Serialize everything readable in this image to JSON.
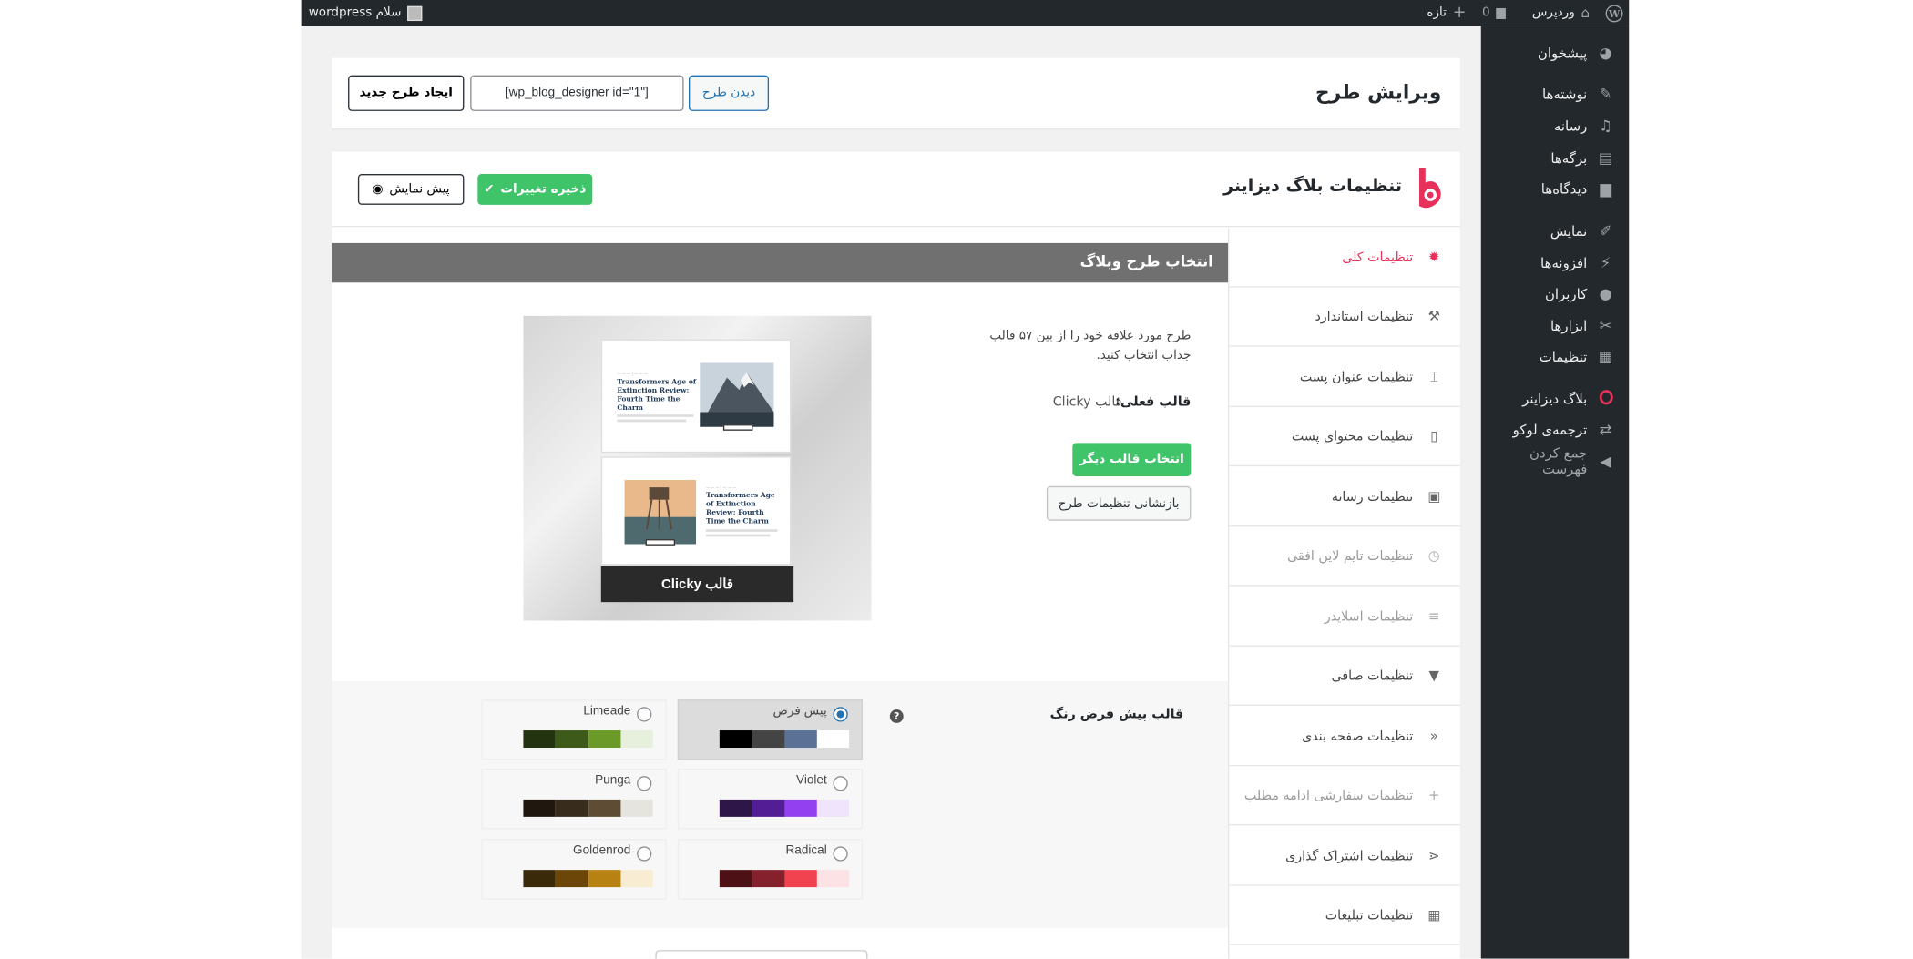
{
  "admin_bar": {
    "site_name": "وردپرس",
    "comments_count": "0",
    "new_label": "تازه",
    "greeting": "سلام wordpress"
  },
  "sidebar": {
    "items": [
      {
        "label": "پیشخوان",
        "icon": "dashboard-icon"
      },
      {
        "label": "نوشته‌ها",
        "icon": "pin-icon"
      },
      {
        "label": "رسانه",
        "icon": "media-icon"
      },
      {
        "label": "برگه‌ها",
        "icon": "pages-icon"
      },
      {
        "label": "دیدگاه‌ها",
        "icon": "comment-icon"
      },
      {
        "label": "نمایش",
        "icon": "brush-icon"
      },
      {
        "label": "افزونه‌ها",
        "icon": "plugin-icon"
      },
      {
        "label": "کاربران",
        "icon": "user-icon"
      },
      {
        "label": "ابزارها",
        "icon": "wrench-icon"
      },
      {
        "label": "تنظیمات",
        "icon": "settings-icon"
      },
      {
        "label": "بلاگ دیزاینر",
        "icon": "blog-designer-icon"
      },
      {
        "label": "ترجمه‌ی لوکو",
        "icon": "translate-icon"
      },
      {
        "label": "جمع کردن فهرست",
        "icon": "collapse-icon"
      }
    ]
  },
  "header": {
    "title": "ویرایش طرح",
    "view_design": "دیدن طرح",
    "shortcode": "[wp_blog_designer id=\"1\"]",
    "create_new": "ایجاد طرح جدید"
  },
  "panel": {
    "brand_title": "تنظیمات بلاگ دیزاینر",
    "save_label": "ذخیره تغییرات",
    "preview_label": "پیش نمایش"
  },
  "tabs": [
    {
      "label": "تنظیمات کلی",
      "icon": "gear-icon",
      "state": "active"
    },
    {
      "label": "تنظیمات استاندارد",
      "icon": "hammer-icon",
      "state": "normal"
    },
    {
      "label": "تنظیمات عنوان پست",
      "icon": "title-icon",
      "state": "normal"
    },
    {
      "label": "تنظیمات محتوای پست",
      "icon": "document-icon",
      "state": "normal"
    },
    {
      "label": "تنظیمات رسانه",
      "icon": "image-icon",
      "state": "normal"
    },
    {
      "label": "تنظیمات تایم لاین افقی",
      "icon": "clock-icon",
      "state": "disabled"
    },
    {
      "label": "تنظیمات اسلایدر",
      "icon": "slider-icon",
      "state": "disabled"
    },
    {
      "label": "تنظیمات صافی",
      "icon": "filter-icon",
      "state": "normal"
    },
    {
      "label": "تنظیمات صفحه بندی",
      "icon": "pagination-icon",
      "state": "normal"
    },
    {
      "label": "تنظیمات سفارشی ادامه مطلب",
      "icon": "plus-icon",
      "state": "disabled"
    },
    {
      "label": "تنظیمات اشتراک گذاری",
      "icon": "share-icon",
      "state": "normal"
    },
    {
      "label": "تنظیمات تبلیغات",
      "icon": "ads-icon",
      "state": "normal"
    }
  ],
  "content": {
    "section_title": "انتخاب طرح وبلاگ",
    "description": "طرح مورد علاقه خود را از بین ۵۷ قالب جذاب انتخاب کنید.",
    "current_label": "قالب فعلی:",
    "current_value": "قالب Clicky",
    "choose_button": "انتخاب قالب دیگر",
    "reset_button": "بازنشانی تنظیمات طرح",
    "preview_caption": "قالب Clicky",
    "mock_post_title": "Transformers Age of Extinction Review: Fourth Time the Charm"
  },
  "color_scheme": {
    "label": "قالب پیش فرض رنگ",
    "help": "?",
    "schemes": [
      {
        "name": "پیش فرض",
        "selected": true,
        "colors": [
          "#000000",
          "#444444",
          "#5b7195",
          "#ffffff"
        ]
      },
      {
        "name": "Limeade",
        "selected": false,
        "colors": [
          "#24330f",
          "#3d5a1a",
          "#6b9a29",
          "#e6f0dd"
        ]
      },
      {
        "name": "Violet",
        "selected": false,
        "colors": [
          "#2e1648",
          "#531d96",
          "#9341f0",
          "#efe4fb"
        ]
      },
      {
        "name": "Punga",
        "selected": false,
        "colors": [
          "#20180f",
          "#382c1c",
          "#5e4d34",
          "#e6e4df"
        ]
      },
      {
        "name": "Radical",
        "selected": false,
        "colors": [
          "#4d1014",
          "#84212c",
          "#f0434f",
          "#fde2e5"
        ]
      },
      {
        "name": "Goldenrod",
        "selected": false,
        "colors": [
          "#3b2a0a",
          "#6b4608",
          "#b88213",
          "#f8ecd3"
        ]
      }
    ]
  }
}
